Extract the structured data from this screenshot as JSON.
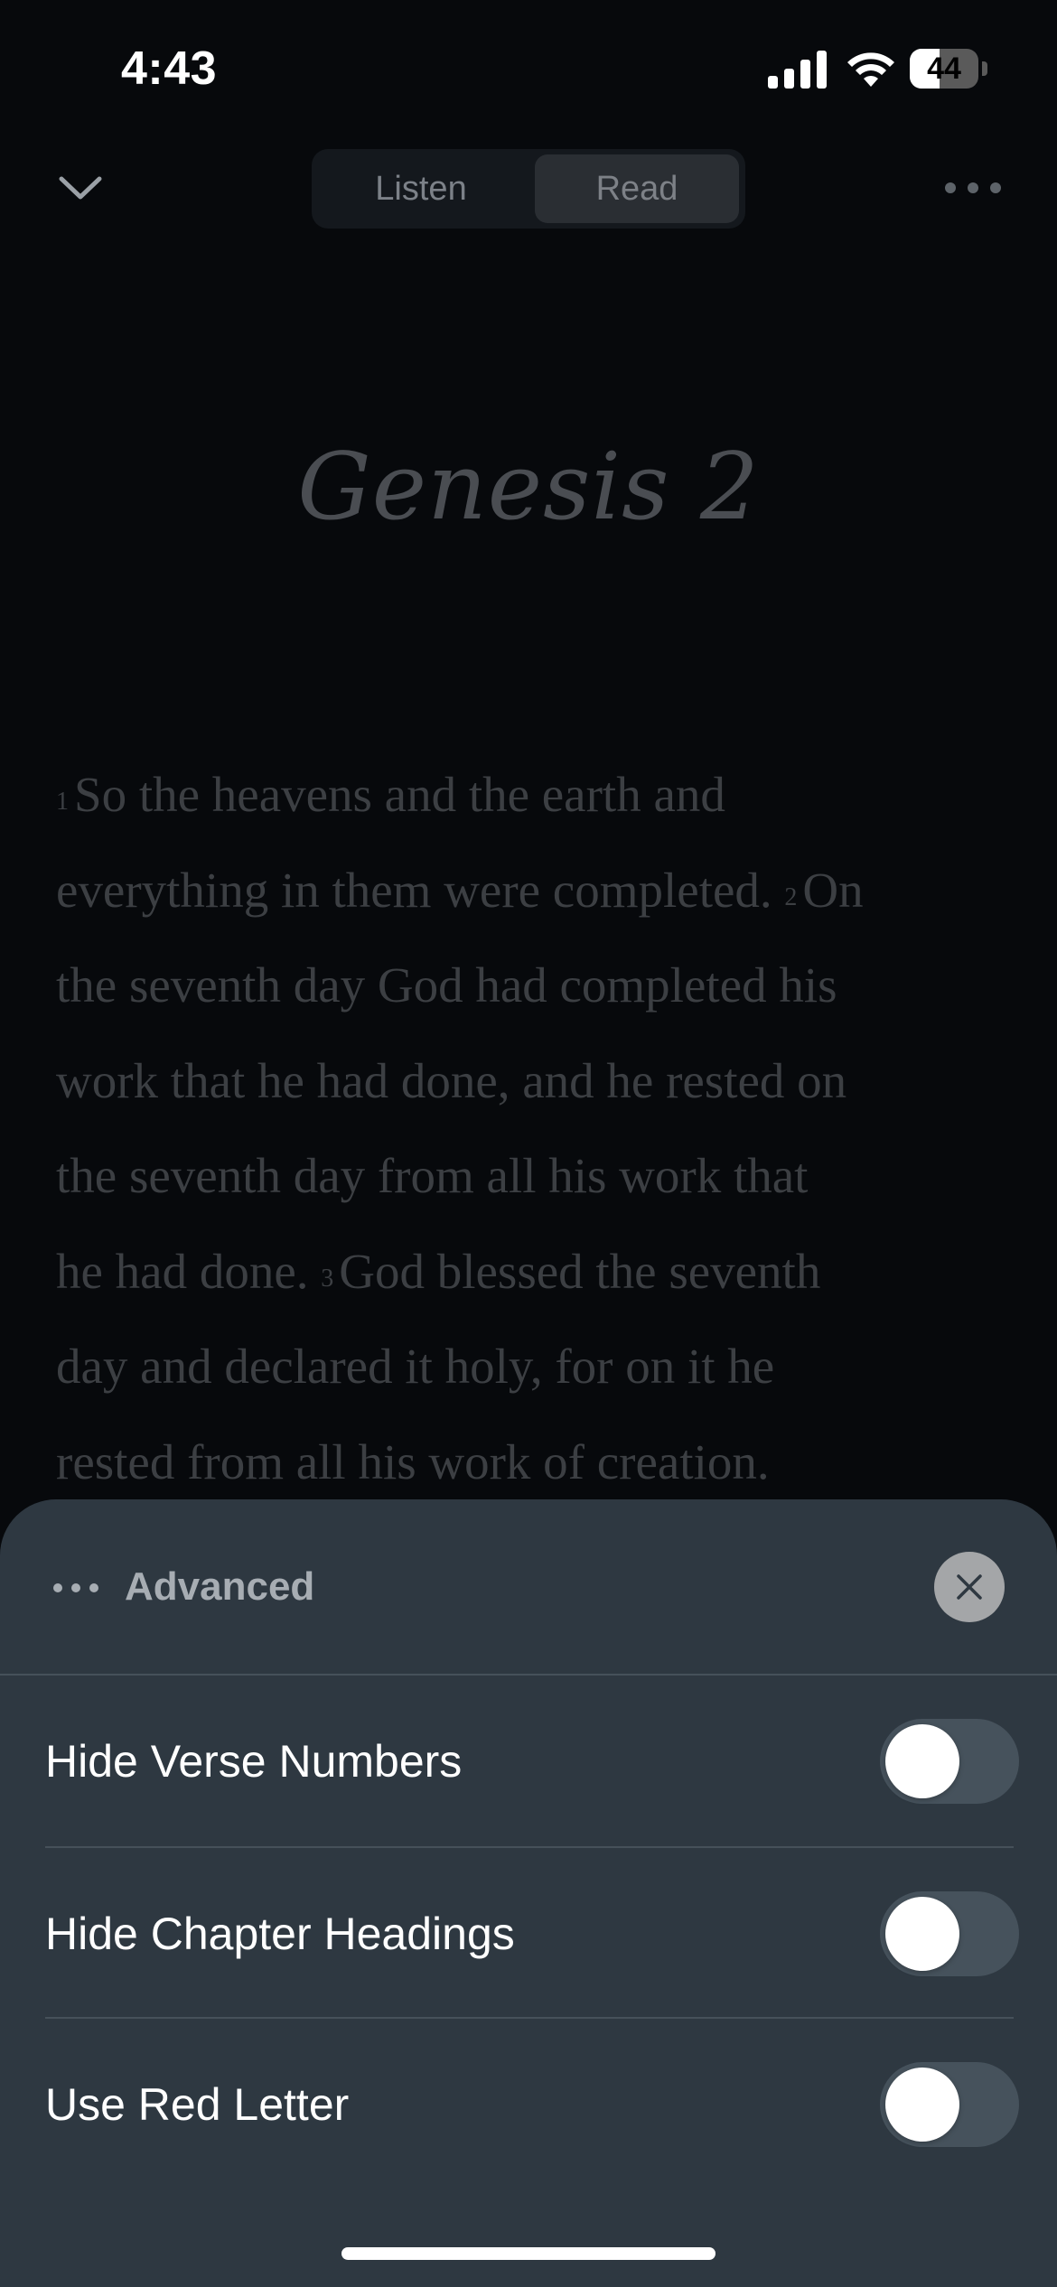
{
  "status_bar": {
    "time": "4:43",
    "battery_level": "44",
    "battery_percent": 44
  },
  "header": {
    "tabs": [
      {
        "label": "Listen",
        "selected": false
      },
      {
        "label": "Read",
        "selected": true
      }
    ]
  },
  "reader": {
    "chapter_title": "Genesis 2",
    "lines": [
      {
        "num": "1",
        "text": "So the heavens and the earth and"
      },
      {
        "num": "",
        "text": "everything in them were completed.",
        "num2": "2",
        "text2": "On"
      },
      {
        "num": "",
        "text": "the seventh day God had completed his"
      },
      {
        "num": "",
        "text": "work that he had done, and he rested on"
      },
      {
        "num": "",
        "text": "the seventh day from all his work that"
      },
      {
        "num": "",
        "text": "he had done.",
        "num2": "3",
        "text2": "God blessed the seventh"
      },
      {
        "num": "",
        "text": "day and declared it holy, for on it he"
      },
      {
        "num": "",
        "text": "rested from all his work of creation."
      }
    ]
  },
  "sheet": {
    "title": "Advanced",
    "options": [
      {
        "label": "Hide Verse Numbers",
        "enabled": false
      },
      {
        "label": "Hide Chapter Headings",
        "enabled": false
      },
      {
        "label": "Use Red Letter",
        "enabled": false
      }
    ]
  },
  "icons": {
    "collapse": "chevron-down-icon",
    "more": "more-horizontal-icon",
    "sheet_menu": "dots-icon",
    "close": "close-icon"
  },
  "colors": {
    "background": "#07090c",
    "sheet_background": "#2e3841",
    "toggle_off": "#46525c"
  }
}
